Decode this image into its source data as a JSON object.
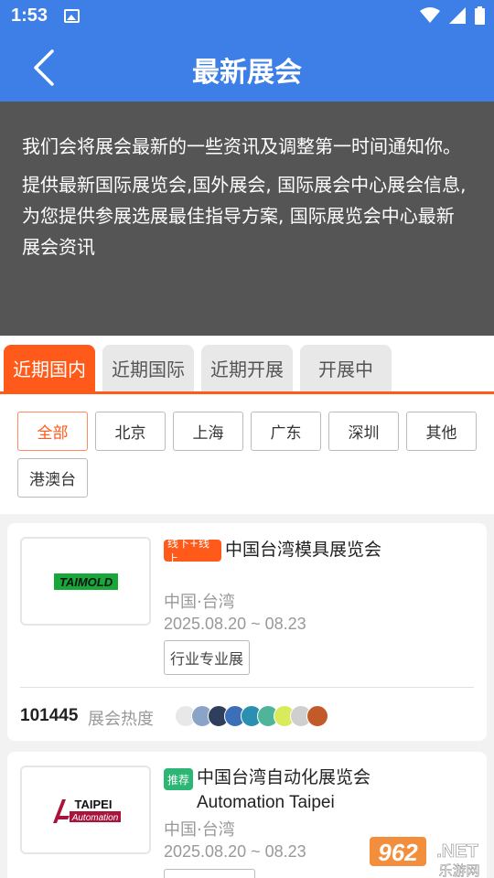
{
  "status_bar": {
    "time": "1:53"
  },
  "header": {
    "title": "最新展会"
  },
  "intro": {
    "paragraph1": "我们会将展会最新的一些资讯及调整第一时间通知你。",
    "paragraph2": "提供最新国际展览会,国外展会, 国际展会中心展会信息,为您提供参展选展最佳指导方案, 国际展览会中心最新展会资讯"
  },
  "tabs": [
    "近期国内",
    "近期国际",
    "近期开展",
    "开展中"
  ],
  "active_tab": "近期国内",
  "filters": [
    "全部",
    "北京",
    "上海",
    "广东",
    "深圳",
    "其他",
    "港澳台"
  ],
  "active_filter": "全部",
  "cards": [
    {
      "badge": "线下+线上",
      "badge_color": "#ff5a1a",
      "title": "中国台湾模具展览会",
      "logo_text": "TAIMOLD",
      "location": "中国·台湾",
      "date": "2025.08.20 ~ 08.23",
      "tag": "行业专业展",
      "heat_count": "101445",
      "heat_label": "展会热度"
    },
    {
      "badge": "推荐",
      "badge_color": "#2bb673",
      "title_line1": "中国台湾自动化展览会",
      "title_line2": "Automation Taipei",
      "logo_text_top": "TAIPEI",
      "logo_text_bottom": "Automation",
      "location": "中国·台湾",
      "date": "2025.08.20 ~ 08.23"
    }
  ],
  "watermark": {
    "top": "962",
    "net": ".NET",
    "bottom": "乐游网"
  },
  "colors": {
    "primary": "#3d7fe6",
    "accent": "#ff5a1a",
    "intro_bg": "#555555"
  }
}
